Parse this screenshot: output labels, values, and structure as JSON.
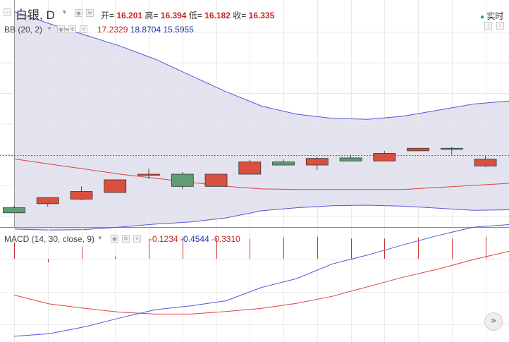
{
  "header": {
    "symbol": "白银",
    "separator": ",",
    "period": "D",
    "open_label": "开=",
    "open_value": "16.201",
    "high_label": "高=",
    "high_value": "16.394",
    "low_label": "低=",
    "low_value": "16.182",
    "close_label": "收=",
    "close_value": "16.335",
    "realtime_label": "实时"
  },
  "bb": {
    "label": "BB (20, 2)",
    "middle": "17.2329",
    "upper": "18.8704",
    "lower": "15.5955"
  },
  "macd": {
    "label": "MACD (14, 30, close, 9)",
    "histogram": "-0.1234",
    "macd": "-0.4544",
    "signal": "-0.3310"
  },
  "colors": {
    "up": "#d95040",
    "down": "#5e9e72",
    "bb_band": "#5555dd",
    "bb_mid": "#e04040",
    "macd_line": "#5555dd",
    "signal_line": "#e04040",
    "hist": "#cc3333",
    "band_fill": "#e3e3ef",
    "value_red": "#cc2222",
    "value_blue": "#2233aa",
    "live_dot": "#22aa44"
  },
  "chart_data": [
    {
      "type": "candlestick",
      "title": "白银, D",
      "ylim": [
        15.0,
        19.3
      ],
      "candles": [
        {
          "open": 15.38,
          "high": 15.42,
          "low": 15.28,
          "close": 15.28
        },
        {
          "open": 15.46,
          "high": 15.52,
          "low": 15.4,
          "close": 15.58
        },
        {
          "open": 15.55,
          "high": 15.8,
          "low": 15.53,
          "close": 15.7
        },
        {
          "open": 15.68,
          "high": 15.93,
          "low": 15.68,
          "close": 15.93
        },
        {
          "open": 16.02,
          "high": 16.15,
          "low": 15.95,
          "close": 16.04
        },
        {
          "open": 16.04,
          "high": 16.08,
          "low": 15.75,
          "close": 15.8
        },
        {
          "open": 15.8,
          "high": 16.04,
          "low": 15.8,
          "close": 16.04
        },
        {
          "open": 16.04,
          "high": 16.32,
          "low": 16.04,
          "close": 16.28
        },
        {
          "open": 16.28,
          "high": 16.33,
          "low": 16.22,
          "close": 16.22
        },
        {
          "open": 16.22,
          "high": 16.38,
          "low": 16.12,
          "close": 16.35
        },
        {
          "open": 16.36,
          "high": 16.42,
          "low": 16.3,
          "close": 16.3
        },
        {
          "open": 16.3,
          "high": 16.5,
          "low": 16.3,
          "close": 16.45
        },
        {
          "open": 16.5,
          "high": 16.56,
          "low": 16.5,
          "close": 16.55
        },
        {
          "open": 16.55,
          "high": 16.58,
          "low": 16.42,
          "close": 16.54
        },
        {
          "open": 16.201,
          "high": 16.394,
          "low": 16.182,
          "close": 16.335
        }
      ],
      "bb_upper": [
        19.24,
        19.0,
        18.78,
        18.56,
        18.3,
        17.98,
        17.66,
        17.38,
        17.22,
        17.14,
        17.12,
        17.18,
        17.3,
        17.42,
        17.48
      ],
      "bb_middle": [
        16.34,
        16.24,
        16.14,
        16.04,
        15.96,
        15.88,
        15.8,
        15.75,
        15.74,
        15.74,
        15.74,
        15.74,
        15.78,
        15.82,
        15.86
      ],
      "bb_lower": [
        14.96,
        14.94,
        14.95,
        15.0,
        15.06,
        15.1,
        15.18,
        15.32,
        15.38,
        15.42,
        15.43,
        15.41,
        15.37,
        15.33,
        15.34
      ],
      "last_price": 16.42
    },
    {
      "type": "line",
      "title": "MACD (14, 30, close, 9)",
      "ylim": [
        -1.35,
        0.45
      ],
      "series": [
        {
          "name": "MACD",
          "values": [
            -1.26,
            -1.22,
            -1.11,
            -0.97,
            -0.84,
            -0.78,
            -0.7,
            -0.49,
            -0.35,
            -0.12,
            0.02,
            0.18,
            0.33,
            0.46,
            0.5
          ]
        },
        {
          "name": "Signal",
          "values": [
            -0.61,
            -0.75,
            -0.82,
            -0.88,
            -0.91,
            -0.91,
            -0.87,
            -0.82,
            -0.74,
            -0.63,
            -0.48,
            -0.33,
            -0.2,
            -0.05,
            0.08
          ]
        }
      ],
      "histogram": [
        0.45,
        -0.1,
        0.32,
        0.06,
        0.55,
        0.6,
        0.58,
        0.55,
        0.58,
        0.6,
        0.55,
        0.55,
        0.58,
        0.55,
        0.6
      ]
    }
  ]
}
